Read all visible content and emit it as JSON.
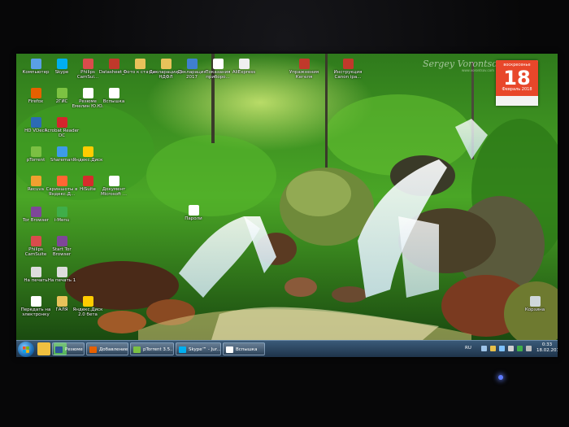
{
  "watermark": {
    "text": "Sergey Vorontsov",
    "url": "www.vorontsov.com"
  },
  "calendar": {
    "weekday": "воскресенье",
    "day": "18",
    "month": "Февраль 2018"
  },
  "desktop_icons": [
    {
      "label": "Компьютер",
      "icon": "computer-icon",
      "color": "#5aa0e6"
    },
    {
      "label": "Skype",
      "icon": "skype-icon",
      "color": "#00aff0"
    },
    {
      "label": "Philips CamSui...",
      "icon": "camera-icon",
      "color": "#d94c4c"
    },
    {
      "label": "Datasheet_...",
      "icon": "pdf-icon",
      "color": "#c0392b"
    },
    {
      "label": "Фото к статье",
      "icon": "folder-icon",
      "color": "#e8c25a"
    },
    {
      "label": "Декларации 3 НДФЛ",
      "icon": "folder-icon",
      "color": "#e8c25a"
    },
    {
      "label": "Декларация 2017",
      "icon": "app-icon",
      "color": "#3f7fcf"
    },
    {
      "label": "Показания приборо...",
      "icon": "document-icon",
      "color": "#ffffff"
    },
    {
      "label": "AliExpress",
      "icon": "document-icon",
      "color": "#f0f0f0"
    },
    {
      "label": "Упражнения Кегеля",
      "icon": "pdf-icon",
      "color": "#c0392b"
    },
    {
      "label": "Инструкция Canon ipa...",
      "icon": "pdf-icon",
      "color": "#c0392b"
    },
    {
      "label": "Firefox",
      "icon": "firefox-icon",
      "color": "#e66000"
    },
    {
      "label": "2ГИС",
      "icon": "map-icon",
      "color": "#7cc242"
    },
    {
      "label": "Резюме Емелин Ю.Ю.",
      "icon": "document-icon",
      "color": "#ffffff"
    },
    {
      "label": "Вспышка",
      "icon": "document-icon",
      "color": "#ffffff"
    },
    {
      "label": "HD VDeck",
      "icon": "video-icon",
      "color": "#2c6bb5"
    },
    {
      "label": "Acrobat Reader DC",
      "icon": "acrobat-icon",
      "color": "#d4262c"
    },
    {
      "label": "pTorrent",
      "icon": "torrent-icon",
      "color": "#7bc043"
    },
    {
      "label": "Shareman",
      "icon": "shareman-icon",
      "color": "#3d9be9"
    },
    {
      "label": "Яндекс.Диск",
      "icon": "cloud-icon",
      "color": "#ffcc00"
    },
    {
      "label": "Recuva",
      "icon": "recuva-icon",
      "color": "#f0a030"
    },
    {
      "label": "Скриншоты в Яндекс.Д...",
      "icon": "scissors-icon",
      "color": "#ff6633"
    },
    {
      "label": "HiSuite",
      "icon": "hisuite-icon",
      "color": "#d62c2c"
    },
    {
      "label": "Документ Microsoft ...",
      "icon": "document-icon",
      "color": "#ffffff"
    },
    {
      "label": "Tor Browser",
      "icon": "tor-icon",
      "color": "#7e4798"
    },
    {
      "label": "i-Menu",
      "icon": "menu-icon",
      "color": "#3fae49"
    },
    {
      "label": "Philips CamSuite",
      "icon": "camera-icon",
      "color": "#d94c4c"
    },
    {
      "label": "Start Tor Browser",
      "icon": "tor-icon",
      "color": "#7e4798"
    },
    {
      "label": "На печать",
      "icon": "printer-icon",
      "color": "#dddddd"
    },
    {
      "label": "На печать 1",
      "icon": "printer-icon",
      "color": "#dddddd"
    },
    {
      "label": "Передать на электронку",
      "icon": "document-icon",
      "color": "#ffffff"
    },
    {
      "label": "ГАЛЯ",
      "icon": "folder-icon",
      "color": "#e8c25a"
    },
    {
      "label": "Яндекс.Диск 2.0 бета",
      "icon": "cloud-icon",
      "color": "#ffcc00"
    },
    {
      "label": "Пароли",
      "icon": "document-icon",
      "color": "#ffffff"
    },
    {
      "label": "Корзина",
      "icon": "recycle-bin-icon",
      "color": "#cfd8dc"
    }
  ],
  "taskbar": {
    "pinned": [
      {
        "icon": "explorer-icon",
        "color": "#f0c040"
      },
      {
        "icon": "chrome-icon",
        "color": "#4caf50"
      }
    ],
    "tasks": [
      {
        "label": "Резюме Еме...",
        "icon": "word-icon",
        "color": "#2b5797"
      },
      {
        "label": "Добавление...",
        "icon": "firefox-icon",
        "color": "#e66000"
      },
      {
        "label": "pTorrent 3.5...",
        "icon": "torrent-icon",
        "color": "#7bc043"
      },
      {
        "label": "Skype™ - Jur...",
        "icon": "skype-icon",
        "color": "#00aff0"
      },
      {
        "label": "Вспышка",
        "icon": "document-icon",
        "color": "#ffffff"
      }
    ],
    "tray": {
      "lang": "RU",
      "time": "0:33",
      "date": "18.02.2018"
    }
  }
}
